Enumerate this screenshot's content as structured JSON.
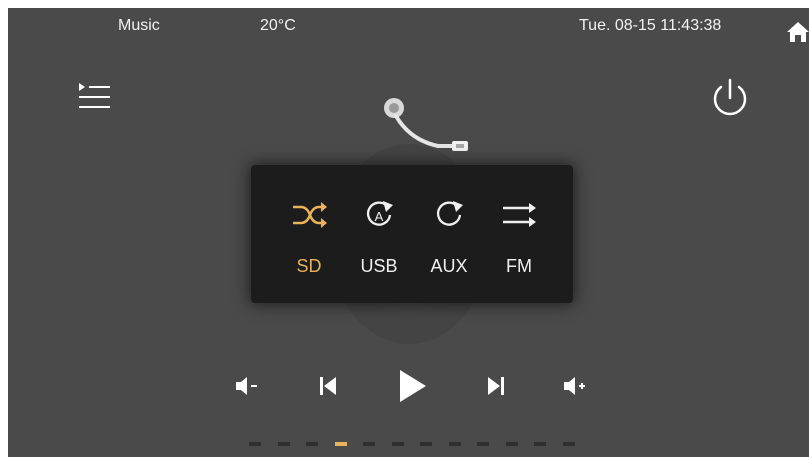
{
  "status_bar": {
    "title": "Music",
    "temperature": "20°C",
    "datetime": "Tue. 08-15 11:43:38"
  },
  "icons": {
    "home": "home-icon",
    "playlist": "playlist-menu-icon",
    "power": "power-icon",
    "tonearm": "tonearm-icon"
  },
  "source_popup": {
    "play_modes": [
      {
        "name": "shuffle",
        "icon": "shuffle-icon",
        "active": true
      },
      {
        "name": "repeat-all",
        "icon": "repeat-a-icon",
        "active": false
      },
      {
        "name": "repeat",
        "icon": "repeat-icon",
        "active": false
      },
      {
        "name": "sequential",
        "icon": "sequential-icon",
        "active": false
      }
    ],
    "sources": [
      "SD",
      "USB",
      "AUX",
      "FM"
    ],
    "active_source": "SD"
  },
  "controls": [
    "volume-down",
    "previous",
    "play",
    "next",
    "volume-up"
  ],
  "page_indicator": {
    "total": 12,
    "active": 4
  },
  "colors": {
    "background": "#4a4a4a",
    "popup": "#1c1c1c",
    "accent": "#e8b35a",
    "text": "#f0f0f0"
  }
}
